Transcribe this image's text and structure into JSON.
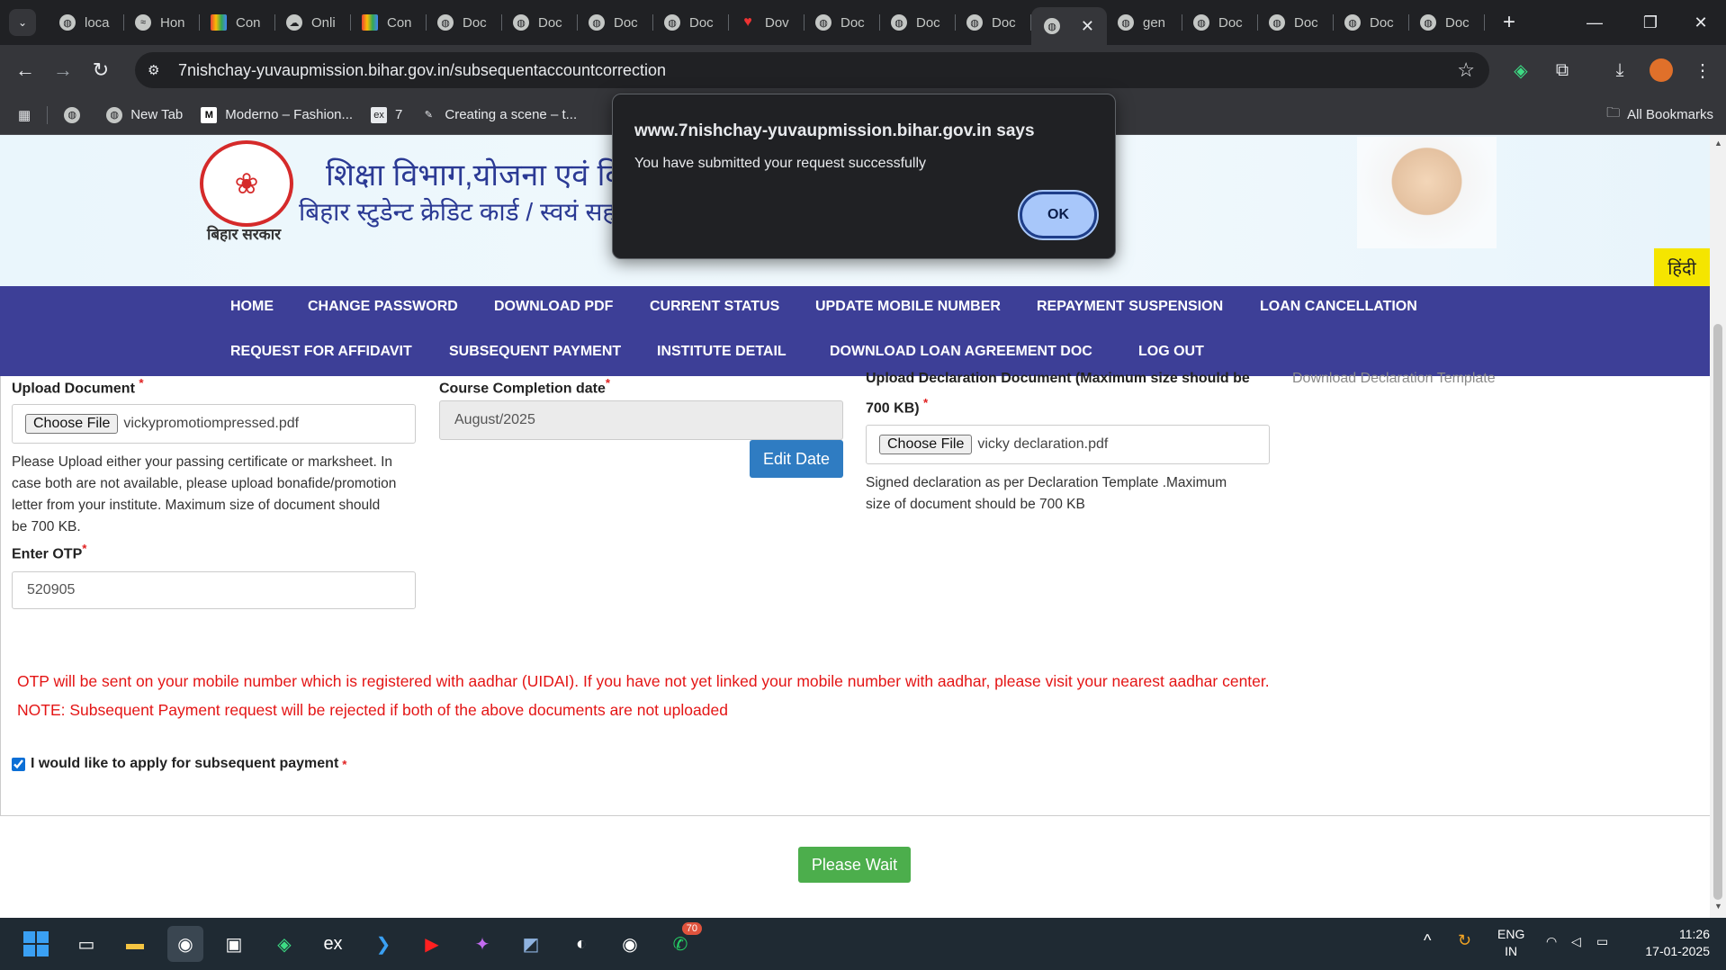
{
  "browser": {
    "tabs": [
      {
        "label": "loca",
        "icon": "globe-icon"
      },
      {
        "label": "Hon",
        "icon": "site-logo-icon"
      },
      {
        "label": "Con",
        "icon": "color-grid-icon"
      },
      {
        "label": "Onli",
        "icon": "cloud-icon"
      },
      {
        "label": "Con",
        "icon": "color-grid-icon"
      },
      {
        "label": "Doc",
        "icon": "globe-icon"
      },
      {
        "label": "Doc",
        "icon": "globe-icon"
      },
      {
        "label": "Doc",
        "icon": "globe-icon"
      },
      {
        "label": "Doc",
        "icon": "globe-icon"
      },
      {
        "label": "Dov",
        "icon": "heart-icon"
      },
      {
        "label": "Doc",
        "icon": "globe-icon"
      },
      {
        "label": "Doc",
        "icon": "globe-icon"
      },
      {
        "label": "Doc",
        "icon": "globe-icon"
      },
      {
        "label": "",
        "icon": "globe-icon",
        "active": true
      },
      {
        "label": "gen",
        "icon": "globe-icon"
      },
      {
        "label": "Doc",
        "icon": "globe-icon"
      },
      {
        "label": "Doc",
        "icon": "globe-icon"
      },
      {
        "label": "Doc",
        "icon": "globe-icon"
      },
      {
        "label": "Doc",
        "icon": "globe-icon"
      }
    ],
    "url": "7nishchay-yuvaupmission.bihar.gov.in/subsequentaccountcorrection",
    "bookmarks": [
      {
        "label": "",
        "icon": "globe-icon"
      },
      {
        "label": "New Tab",
        "icon": "globe-icon"
      },
      {
        "label": "Moderno – Fashion...",
        "icon": "m-logo-icon"
      },
      {
        "label": "7",
        "icon": "ex-logo-icon"
      },
      {
        "label": "Creating a scene – t...",
        "icon": "scene-icon"
      }
    ],
    "all_bookmarks": "All Bookmarks"
  },
  "header": {
    "govt_name": "बिहार सरकार",
    "dept_title": "शिक्षा विभाग,योजना एवं विक",
    "dept_subtitle": "बिहार स्टुडेन्ट क्रेडिट कार्ड / स्वयं सह",
    "language_button": "हिंदी"
  },
  "nav": {
    "row1": [
      "HOME",
      "CHANGE PASSWORD",
      "DOWNLOAD PDF",
      "CURRENT STATUS",
      "UPDATE MOBILE NUMBER",
      "REPAYMENT SUSPENSION",
      "LOAN CANCELLATION"
    ],
    "row2": [
      "REQUEST FOR AFFIDAVIT",
      "SUBSEQUENT PAYMENT",
      "INSTITUTE DETAIL",
      "DOWNLOAD LOAN AGREEMENT DOC",
      "LOG OUT"
    ]
  },
  "form": {
    "upload_doc_label": "Upload Document",
    "upload_doc_file": "vickypromotiompressed.pdf",
    "choose_file": "Choose File",
    "upload_doc_help": [
      "Please Upload either your passing certificate or marksheet. In",
      "case both are not available, please upload bonafide/promotion",
      "letter from your institute. Maximum size of document should",
      "be 700 KB."
    ],
    "course_completion_label": "Course Completion date",
    "course_completion_value": "August/2025",
    "edit_date": "Edit Date",
    "declaration_label_1": "Upload Declaration Document (Maximum size should be",
    "declaration_label_2": "700 KB)",
    "declaration_file": "vicky declaration.pdf",
    "declaration_help": [
      "Signed declaration as per Declaration Template .Maximum",
      "size of document should be 700 KB"
    ],
    "download_template": "Download Declaration Template",
    "otp_label": "Enter OTP",
    "otp_value": "520905",
    "required_mark": "*",
    "otp_note": "OTP will be sent on your mobile number which is registered with aadhar (UIDAI). If you have not yet linked your mobile number with aadhar, please visit your nearest aadhar center.",
    "rejection_note": "NOTE: Subsequent Payment request will be rejected if both of the above documents are not uploaded",
    "apply_label": "I would like to apply for subsequent payment",
    "apply_checked": true,
    "submit_button": "Please Wait"
  },
  "dialog": {
    "title": "www.7nishchay-yuvaupmission.bihar.gov.in says",
    "message": "You have submitted your request successfully",
    "ok": "OK"
  },
  "taskbar": {
    "badge": "70",
    "lang": "ENG",
    "region": "IN",
    "time": "11:26",
    "date": "17-01-2025"
  },
  "colors": {
    "nav_bg": "#3d3f97",
    "edit_btn": "#2f7cc2",
    "submit_btn": "#4cae4c",
    "warning_text": "#e41515",
    "dialog_bg": "#202124"
  }
}
